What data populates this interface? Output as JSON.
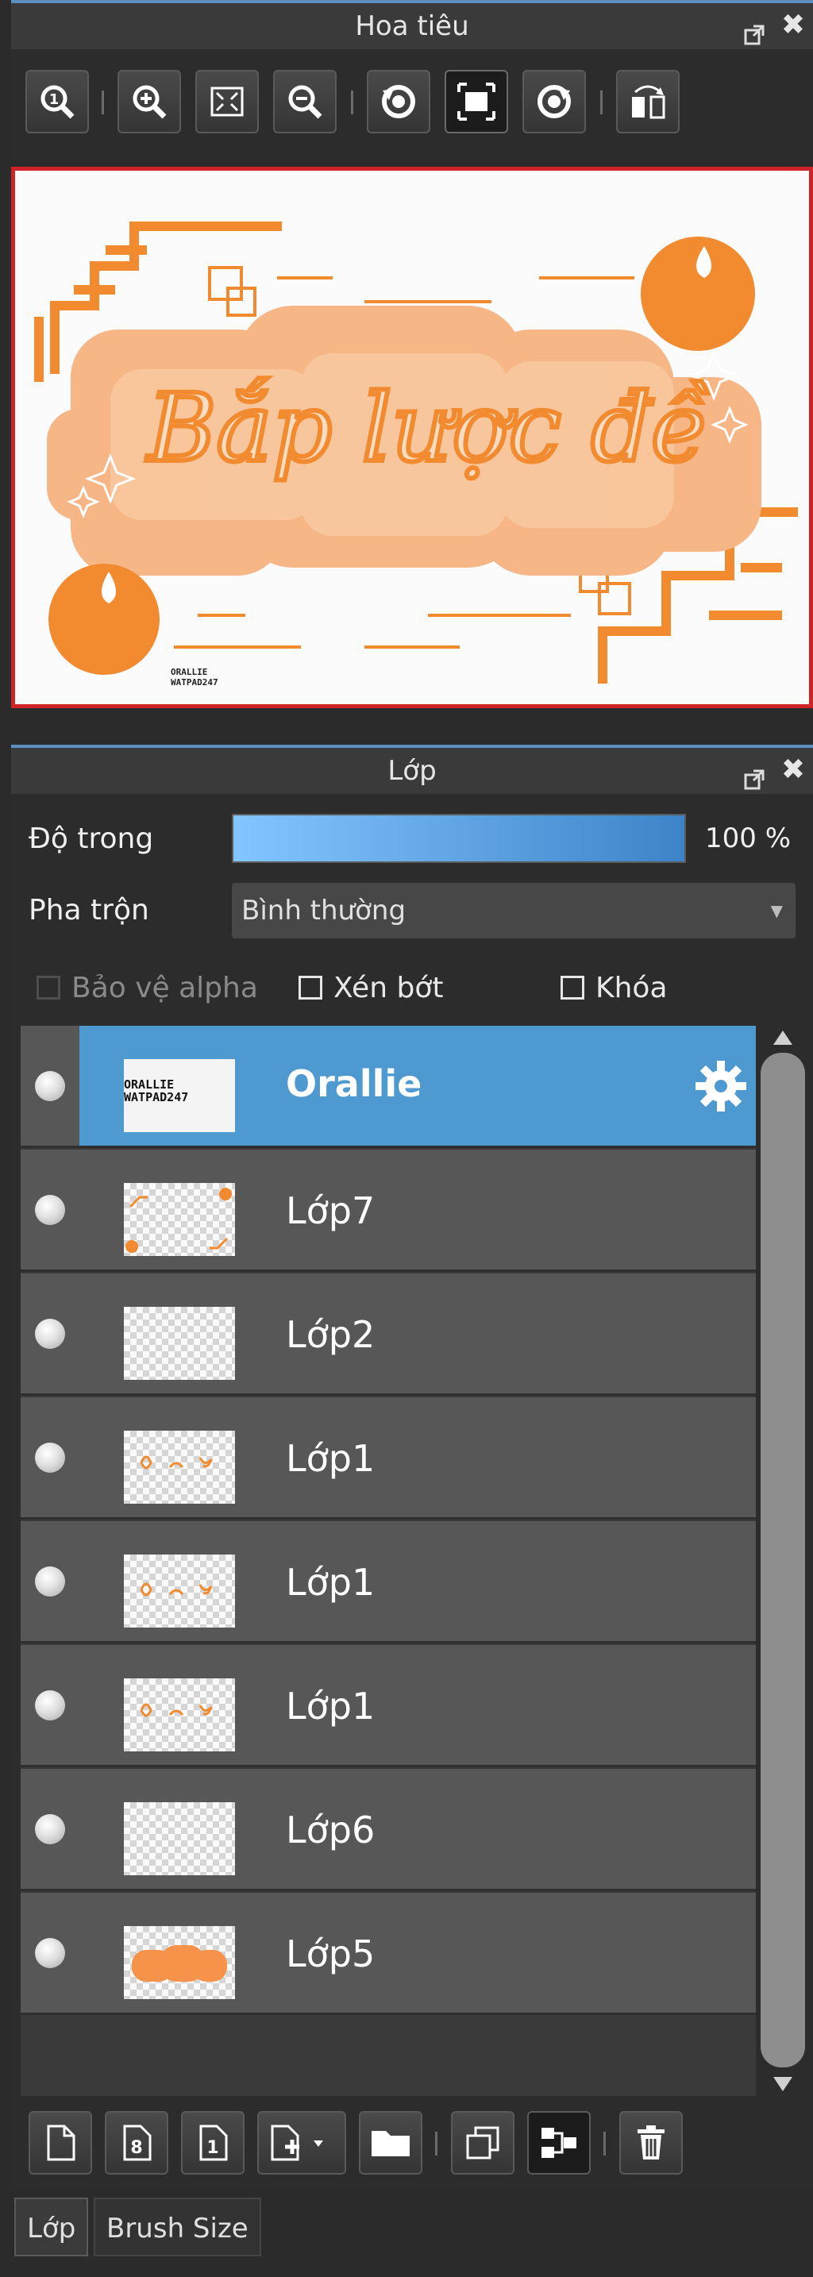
{
  "navigator": {
    "title": "Hoa tiêu",
    "toolbar": [
      "zoom-actual-icon",
      "zoom-in-icon",
      "fit-screen-icon",
      "zoom-out-icon",
      "rotate-left-icon",
      "fullscreen-icon",
      "rotate-right-icon",
      "flip-icon"
    ]
  },
  "preview": {
    "title_art": "Bắp lược đề",
    "watermark_line1": "ORALLIE",
    "watermark_line2": "WATPAD247"
  },
  "layers_panel": {
    "title": "Lớp",
    "opacity_label": "Độ trong",
    "opacity_value": "100 %",
    "opacity_fraction": 1.0,
    "blend_label": "Pha trộn",
    "blend_value": "Bình thường",
    "protect_alpha_label": "Bảo vệ alpha",
    "clip_label": "Xén bớt",
    "lock_label": "Khóa",
    "layers": [
      {
        "name": "Orallie",
        "selected": true
      },
      {
        "name": "Lớp7"
      },
      {
        "name": "Lớp2"
      },
      {
        "name": "Lớp1"
      },
      {
        "name": "Lớp1"
      },
      {
        "name": "Lớp1"
      },
      {
        "name": "Lớp6"
      },
      {
        "name": "Lớp5"
      }
    ],
    "thumb_watermark_line1": "ORALLIE",
    "thumb_watermark_line2": "WATPAD247"
  },
  "bottom_tabs": {
    "layer_tab": "Lớp",
    "brush_tab": "Brush Size"
  },
  "colors": {
    "accent_orange": "#f28a2f",
    "selected_blue": "#4f99d1",
    "preview_border": "#cf2427"
  }
}
